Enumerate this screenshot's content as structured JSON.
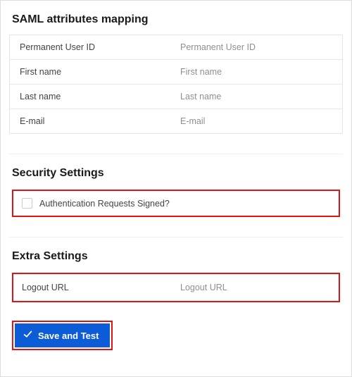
{
  "sections": {
    "saml": {
      "heading": "SAML attributes mapping",
      "rows": [
        {
          "label": "Permanent User ID",
          "placeholder": "Permanent User ID",
          "value": ""
        },
        {
          "label": "First name",
          "placeholder": "First name",
          "value": ""
        },
        {
          "label": "Last name",
          "placeholder": "Last name",
          "value": ""
        },
        {
          "label": "E-mail",
          "placeholder": "E-mail",
          "value": ""
        }
      ]
    },
    "security": {
      "heading": "Security Settings",
      "auth_signed_label": "Authentication Requests Signed?"
    },
    "extra": {
      "heading": "Extra Settings",
      "logout_url_label": "Logout URL",
      "logout_url_placeholder": "Logout URL",
      "logout_url_value": ""
    }
  },
  "actions": {
    "save_label": "Save and Test"
  },
  "colors": {
    "highlight": "#e11313",
    "primary": "#0b5cd6"
  }
}
